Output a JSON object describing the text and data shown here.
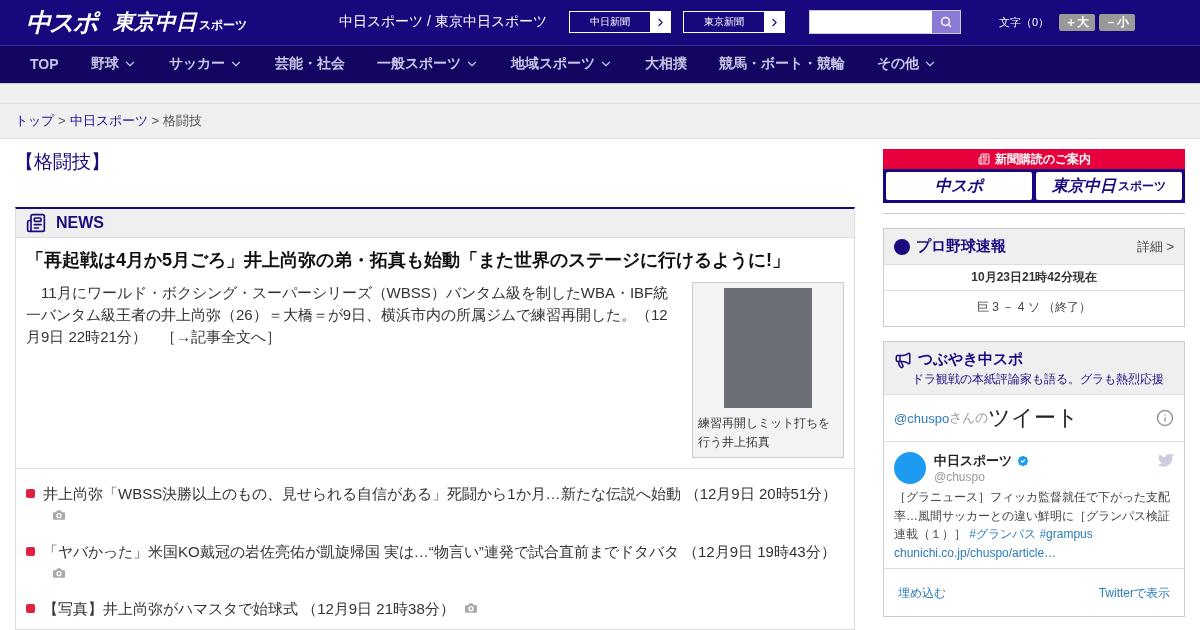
{
  "header": {
    "logo_main": "中スポ",
    "logo_sub": "東京中日",
    "logo_sub_small": "スポーツ",
    "site_title": "中日スポーツ / 東京中日スポーツ",
    "links": [
      "中日新聞",
      "東京新聞"
    ],
    "font_size_label": "文字（0）",
    "font_buttons": [
      "＋大",
      "－小"
    ]
  },
  "nav": [
    {
      "label": "TOP",
      "dropdown": false
    },
    {
      "label": "野球",
      "dropdown": true
    },
    {
      "label": "サッカー",
      "dropdown": true
    },
    {
      "label": "芸能・社会",
      "dropdown": false
    },
    {
      "label": "一般スポーツ",
      "dropdown": true
    },
    {
      "label": "地域スポーツ",
      "dropdown": true
    },
    {
      "label": "大相撲",
      "dropdown": false
    },
    {
      "label": "競馬・ボート・競輪",
      "dropdown": false
    },
    {
      "label": "その他",
      "dropdown": true
    }
  ],
  "breadcrumb": {
    "links": [
      "トップ",
      "中日スポーツ"
    ],
    "separators": [
      ">",
      ">"
    ],
    "current": "格闘技"
  },
  "page_title": "【格闘技】",
  "news": {
    "heading": "NEWS",
    "headline": "「再起戦は4月か5月ごろ」井上尚弥の弟・拓真も始動「また世界のステージに行けるように!」",
    "lead": "　11月にワールド・ボクシング・スーパーシリーズ（WBSS）バンタム級を制したWBA・IBF統一バンタム級王者の井上尚弥（26）＝大橋＝が9日、横浜市内の所属ジムで練習再開した。",
    "lead_time": "（12月9日 22時21分）",
    "lead_link": "［→記事全文へ］",
    "photo_caption": "練習再開しミット打ちを行う井上拓真",
    "items": [
      {
        "title": "井上尚弥「WBSS決勝以上のもの、見せられる自信がある」死闘から1か月…新たな伝説へ始動",
        "time": "（12月9日 20時51分）",
        "photo": true
      },
      {
        "title": "「ヤバかった」米国KO戴冠の岩佐亮佑が凱旋帰国 実は…“物言い”連発で試合直前までドタバタ",
        "time": "（12月9日 19時43分）",
        "photo": true
      },
      {
        "title": "【写真】井上尚弥がハマスタで始球式",
        "time": "（12月9日 21時38分）",
        "photo": true
      }
    ]
  },
  "sidebar": {
    "subscribe": {
      "title": "新聞購読のご案内",
      "buttons": [
        "中スポ",
        "東京中日"
      ],
      "button_small": "スポーツ"
    },
    "baseball": {
      "title": "プロ野球速報",
      "detail": "詳細 >",
      "updated": "10月23日21時42分現在",
      "score": "巨 3 － 4 ソ （終了）"
    },
    "tweets": {
      "title": "つぶやき中スポ",
      "subtitle": "ドラ観戦の本紙評論家も語る。グラも熱烈応援",
      "handle_link": "@chuspo",
      "handle_suffix": "さんの",
      "heading": "ツイート",
      "account_name": "中日スポーツ",
      "verified": true,
      "account_handle": "@chuspo",
      "text": "［グラニュース］フィッカ監督就任で下がった支配率…風間サッカーとの違い鮮明に［グランパス検証連載（１）］",
      "hashtags": [
        "#グランパス",
        "#grampus"
      ],
      "url": "chunichi.co.jp/chuspo/article…",
      "footer": [
        "埋め込む",
        "Twitterで表示"
      ]
    }
  }
}
